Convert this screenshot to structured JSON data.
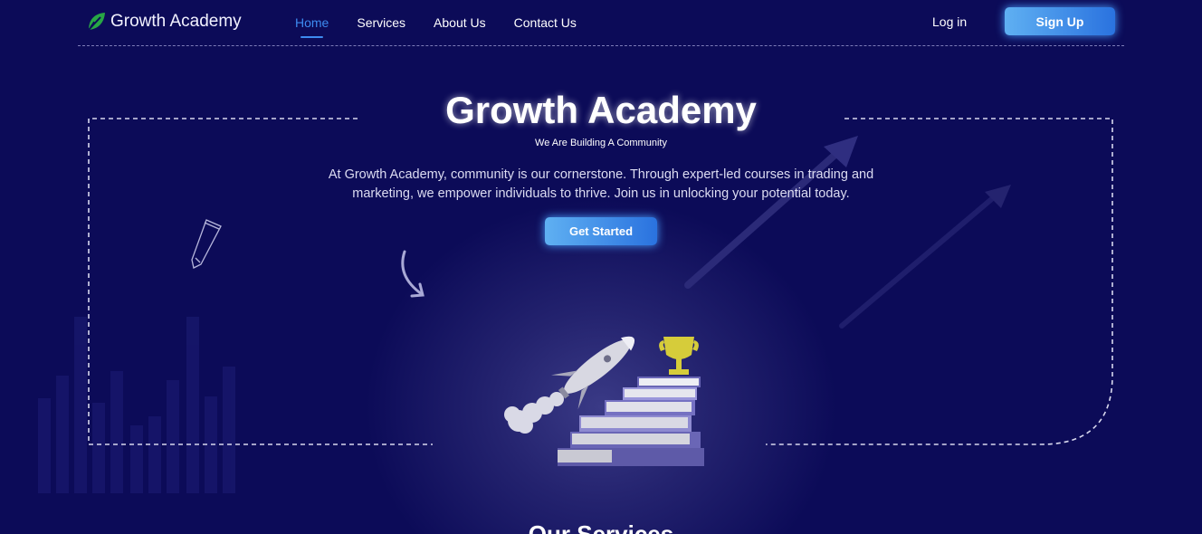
{
  "brand": {
    "name": "Growth Academy",
    "logo_icon": "leaf-icon",
    "accent": "#3d8bf0"
  },
  "nav": {
    "links": [
      {
        "label": "Home",
        "active": true
      },
      {
        "label": "Services",
        "active": false
      },
      {
        "label": "About Us",
        "active": false
      },
      {
        "label": "Contact Us",
        "active": false
      }
    ],
    "login_label": "Log in",
    "signup_label": "Sign Up"
  },
  "hero": {
    "title": "Growth Academy",
    "subtitle": "We Are Building A Community",
    "description": "At Growth Academy, community is our cornerstone. Through expert-led courses in trading and marketing, we empower individuals to thrive. Join us in unlocking your potential today.",
    "cta_label": "Get Started",
    "illustration": "rocket-books-trophy-illustration"
  },
  "next_section": {
    "title": "Our Services"
  },
  "colors": {
    "background": "#0c0b58",
    "button_gradient_start": "#5fb0f2",
    "button_gradient_end": "#2a72df"
  }
}
